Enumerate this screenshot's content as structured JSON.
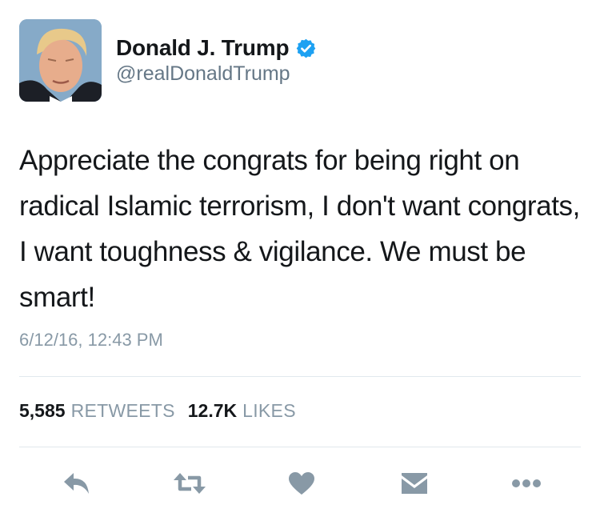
{
  "tweet": {
    "author": {
      "name": "Donald J. Trump",
      "handle": "@realDonaldTrump",
      "verified": true
    },
    "text": "Appreciate the congrats for being right on radical Islamic terrorism, I don't want congrats, I want toughness & vigilance. We must be smart!",
    "timestamp": "6/12/16, 12:43 PM",
    "stats": {
      "retweets_count": "5,585",
      "retweets_label": "RETWEETS",
      "likes_count": "12.7K",
      "likes_label": "LIKES"
    },
    "actions": [
      "reply-icon",
      "retweet-icon",
      "like-icon",
      "direct-message-icon",
      "more-icon"
    ]
  },
  "colors": {
    "text": "#14171a",
    "secondary": "#657786",
    "muted": "#8899a6",
    "verified": "#1da1f2",
    "divider": "#e1e8ed"
  }
}
